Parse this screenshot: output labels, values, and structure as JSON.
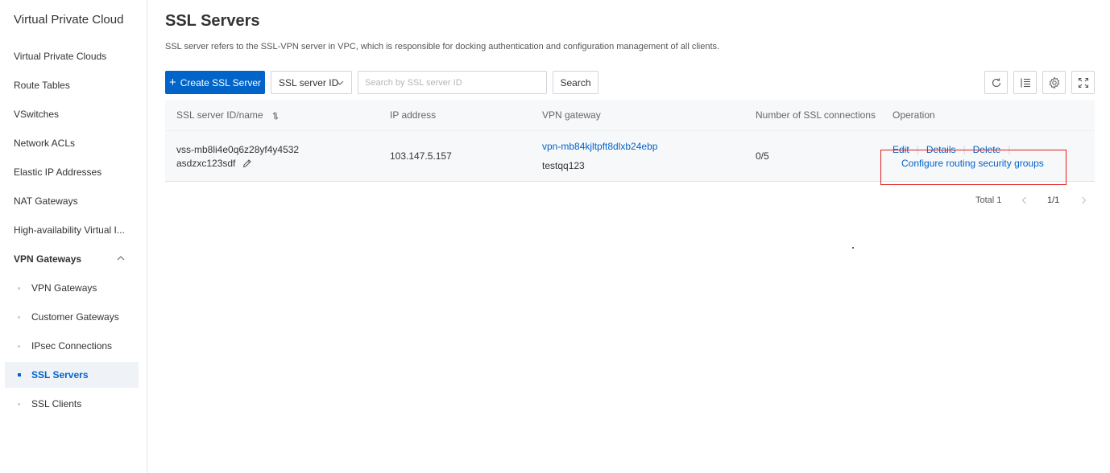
{
  "sidebar": {
    "title": "Virtual Private Cloud",
    "items": [
      {
        "label": "Virtual Private Clouds"
      },
      {
        "label": "Route Tables"
      },
      {
        "label": "VSwitches"
      },
      {
        "label": "Network ACLs"
      },
      {
        "label": "Elastic IP Addresses"
      },
      {
        "label": "NAT Gateways"
      },
      {
        "label": "High-availability Virtual I..."
      },
      {
        "label": "VPN Gateways"
      }
    ],
    "subitems": [
      {
        "label": "VPN Gateways"
      },
      {
        "label": "Customer Gateways"
      },
      {
        "label": "IPsec Connections"
      },
      {
        "label": "SSL Servers"
      },
      {
        "label": "SSL Clients"
      }
    ],
    "active_subitem": "SSL Servers"
  },
  "page": {
    "title": "SSL Servers",
    "description": "SSL server refers to the SSL-VPN server in VPC, which is responsible for docking authentication and configuration management of all clients."
  },
  "toolbar": {
    "create_label": "Create SSL Server",
    "filter_select": "SSL server ID",
    "search_placeholder": "Search by SSL server ID",
    "search_label": "Search",
    "tools": [
      "refresh-icon",
      "column-settings-icon",
      "gear-icon",
      "fullscreen-icon"
    ]
  },
  "table": {
    "headers": [
      "SSL server ID/name",
      "IP address",
      "VPN gateway",
      "Number of SSL connections",
      "Operation"
    ],
    "rows": [
      {
        "id": "vss-mb8li4e0q6z28yf4y4532",
        "name": "asdzxc123sdf",
        "ip": "103.147.5.157",
        "vpn_gateway_id": "vpn-mb84kjltpft8dlxb24ebp",
        "vpn_gateway_name": "testqq123",
        "connections": "0/5",
        "operations": [
          "Edit",
          "Details",
          "Delete"
        ],
        "extra_operation": "Configure routing security groups"
      }
    ]
  },
  "pagination": {
    "total": "Total 1",
    "page": "1/1"
  },
  "colors": {
    "primary": "#0064c8",
    "highlight": "#e02020",
    "table_bg": "#f7f8fa"
  }
}
